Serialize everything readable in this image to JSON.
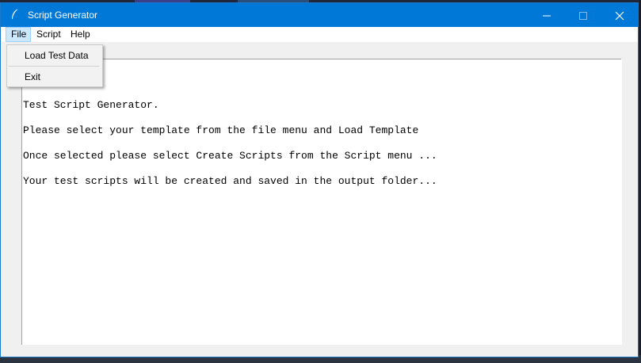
{
  "window": {
    "title": "Script Generator",
    "icon": "feather-icon",
    "controls": {
      "minimize": "minimize-icon",
      "maximize": "maximize-icon",
      "close": "close-icon"
    }
  },
  "menubar": {
    "items": [
      {
        "label": "File"
      },
      {
        "label": "Script"
      },
      {
        "label": "Help"
      }
    ],
    "active": "File"
  },
  "file_menu": {
    "items": [
      {
        "label": "Load Test Data"
      },
      {
        "label": "Exit"
      }
    ]
  },
  "content": {
    "lines": [
      "Test Script Generator.",
      "Please select your template from the file menu and Load Template",
      "Once selected please select Create Scripts from the Script menu ...",
      "Your test scripts will be created and saved in the output folder..."
    ]
  },
  "colors": {
    "titlebar": "#0078d7",
    "menu_highlight": "#cce8ff",
    "background": "#f0f0f0"
  }
}
